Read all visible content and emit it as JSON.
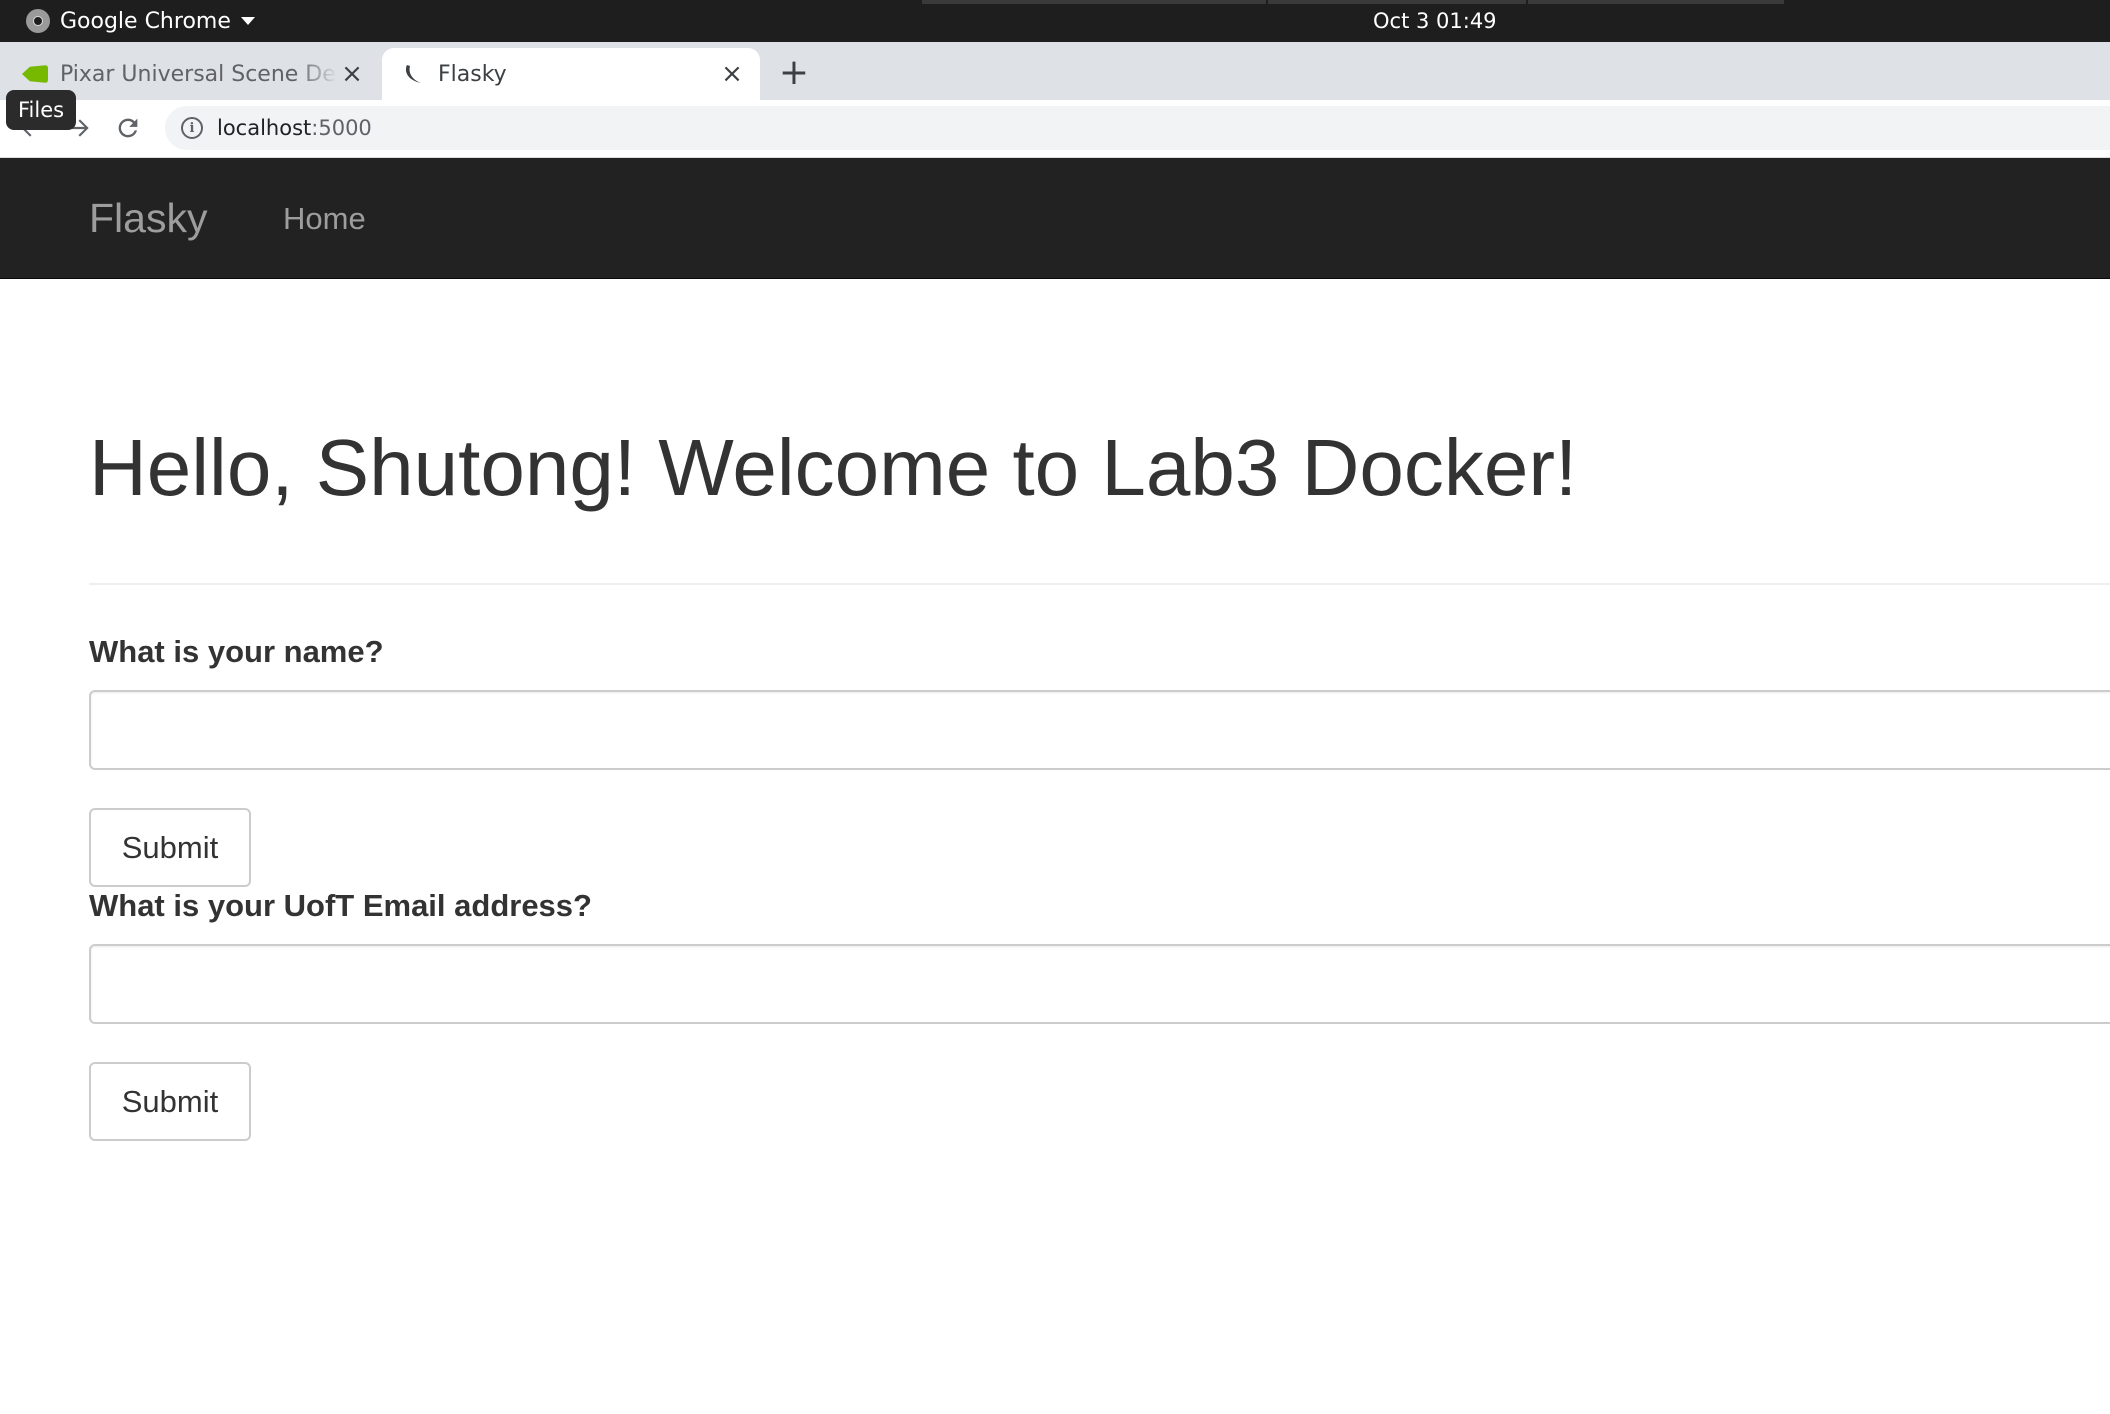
{
  "system_bar": {
    "app_name": "Google Chrome",
    "clock": "Oct 3  01:49",
    "icons": {
      "app": "chrome-logo-icon",
      "menu": "caret-down-icon"
    }
  },
  "browser": {
    "tabs": [
      {
        "title": "Pixar Universal Scene Description",
        "favicon": "nvidia-icon",
        "active": false
      },
      {
        "title": "Flasky",
        "favicon": "flask-icon",
        "active": true
      }
    ],
    "new_tab": "+",
    "tab_close": "×",
    "url_host": "localhost",
    "url_port": ":5000",
    "tooltip": "Files",
    "icons": {
      "back": "back-arrow-icon",
      "forward": "forward-arrow-icon",
      "reload": "reload-icon",
      "site_info": "info-icon"
    }
  },
  "site": {
    "brand": "Flasky",
    "nav": [
      {
        "label": "Home"
      }
    ],
    "colors": {
      "navbar_bg": "#222222",
      "navbar_text": "#9d9d9d",
      "text": "#333333"
    }
  },
  "page": {
    "heading": "Hello, Shutong! Welcome to Lab3 Docker!",
    "forms": [
      {
        "label": "What is your name?",
        "value": "",
        "submit": "Submit"
      },
      {
        "label": "What is your UofT Email address?",
        "value": "",
        "submit": "Submit"
      }
    ]
  }
}
